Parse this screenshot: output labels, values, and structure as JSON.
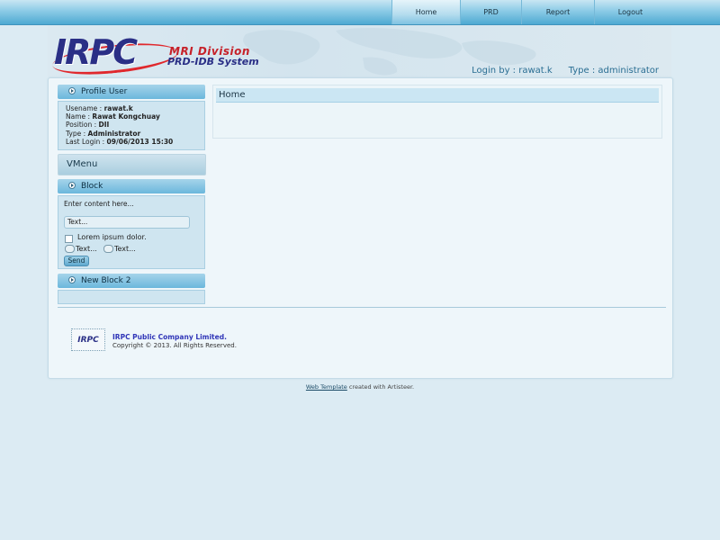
{
  "nav": {
    "items": [
      {
        "label": "Home",
        "active": true
      },
      {
        "label": "PRD",
        "active": false
      },
      {
        "label": "Report",
        "active": false
      },
      {
        "label": "Logout",
        "active": false
      }
    ]
  },
  "header": {
    "logo_brand": "IRPC",
    "logo_line1": "MRI Division",
    "logo_line2": "PRD-IDB System",
    "login_by": "Login by : rawat.k",
    "type": "Type : administrator"
  },
  "profile": {
    "title": "Profile User",
    "rows": [
      {
        "label": "Usename : ",
        "value": "rawat.k"
      },
      {
        "label": "Name : ",
        "value": "Rawat Kongchuay"
      },
      {
        "label": "Position : ",
        "value": "DII"
      },
      {
        "label": "Type : ",
        "value": "Administrator"
      },
      {
        "label": "Last Login : ",
        "value": "09/06/2013 15:30"
      }
    ]
  },
  "vmenu": {
    "title": "VMenu"
  },
  "block": {
    "title": "Block",
    "intro": "Enter content here...",
    "input_value": "Text...",
    "checkbox_label": "Lorem ipsum dolor.",
    "radio1_label": "Text...",
    "radio2_label": "Text...",
    "send_label": "Send"
  },
  "block2": {
    "title": "New Block 2"
  },
  "content": {
    "title": "Home"
  },
  "footer": {
    "logo_text": "IRPC",
    "company": "IRPC Public Company Limited.",
    "copyright": "Copyright © 2013. All Rights Reserved."
  },
  "credit": {
    "link": "Web Template",
    "text": " created with Artisteer."
  },
  "colors": {
    "background": "#dcebf3",
    "nav_blue": "#4ea9d2",
    "brand_navy": "#2a2f86",
    "brand_red": "#c62129"
  }
}
